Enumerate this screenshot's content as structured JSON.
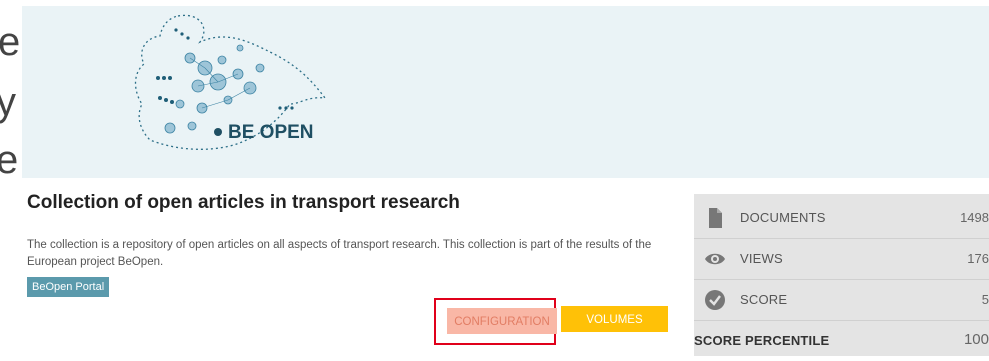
{
  "edge_text": [
    "e",
    "y",
    "e"
  ],
  "logo": {
    "text": "BE OPEN",
    "icon": "be-open-network-map-logo"
  },
  "collection": {
    "title": "Collection of open articles in transport research",
    "description": "The collection is a repository of open articles on all aspects of transport research. This collection is part of the results of the European project BeOpen.",
    "portal_button": "BeOpen Portal"
  },
  "actions": {
    "configuration_label": "CONFIGURATION",
    "volumes_label": "VOLUMES",
    "highlight_color": "#e0001a"
  },
  "stats": [
    {
      "icon": "document-icon",
      "label": "DOCUMENTS",
      "value": "1498"
    },
    {
      "icon": "eye-icon",
      "label": "VIEWS",
      "value": "176"
    },
    {
      "icon": "check-circle-icon",
      "label": "SCORE",
      "value": "5"
    },
    {
      "icon": "",
      "label": "SCORE PERCENTILE",
      "value": "100"
    }
  ],
  "colors": {
    "hero_bg": "#eaf3f6",
    "portal_button": "#5b9aac",
    "volumes_button": "#ffc107",
    "configuration_button": "#f9b7a6",
    "stats_panel": "#e4e4e4"
  }
}
